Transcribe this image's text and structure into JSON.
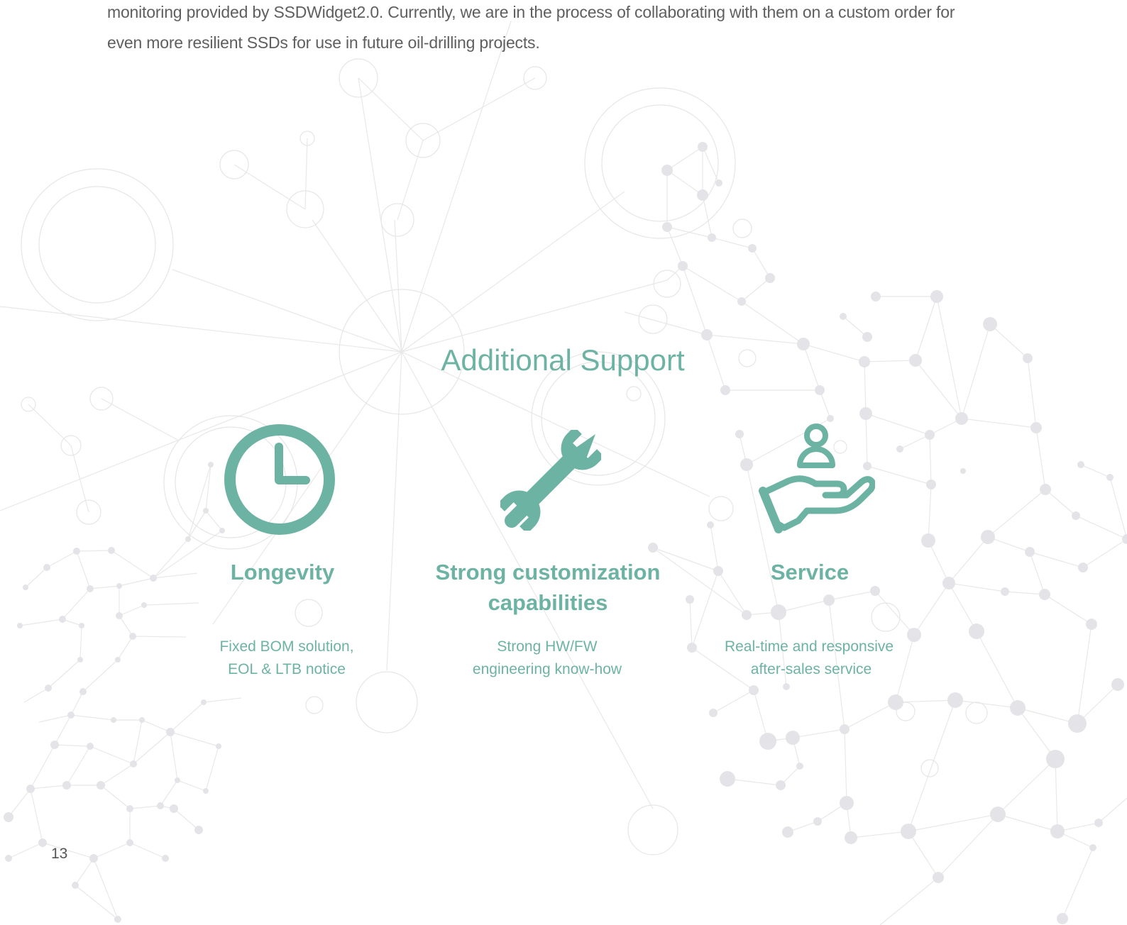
{
  "intro": {
    "line1": "monitoring provided by SSDWidget2.0. Currently, we are in the process of collaborating with them on a custom order for",
    "line2": "even more resilient SSDs for use in future oil-drilling projects."
  },
  "section": {
    "title": "Additional Support"
  },
  "features": [
    {
      "icon": "clock-icon",
      "title_lines": [
        "Longevity"
      ],
      "desc_lines": [
        "Fixed BOM solution,",
        "EOL & LTB notice"
      ]
    },
    {
      "icon": "wrench-screwdriver-icon",
      "title_lines": [
        "Strong customization",
        "capabilities"
      ],
      "desc_lines": [
        "Strong HW/FW",
        "engineering know-how"
      ]
    },
    {
      "icon": "hand-person-icon",
      "title_lines": [
        "Service"
      ],
      "desc_lines": [
        "Real-time and responsive",
        "after-sales service"
      ]
    }
  ],
  "colors": {
    "accent": "#6db3a4",
    "body_text": "#5f5f5f",
    "network_lines": "#e6e6e6",
    "network_nodes": "#e9e9ec"
  },
  "page_number": "13"
}
